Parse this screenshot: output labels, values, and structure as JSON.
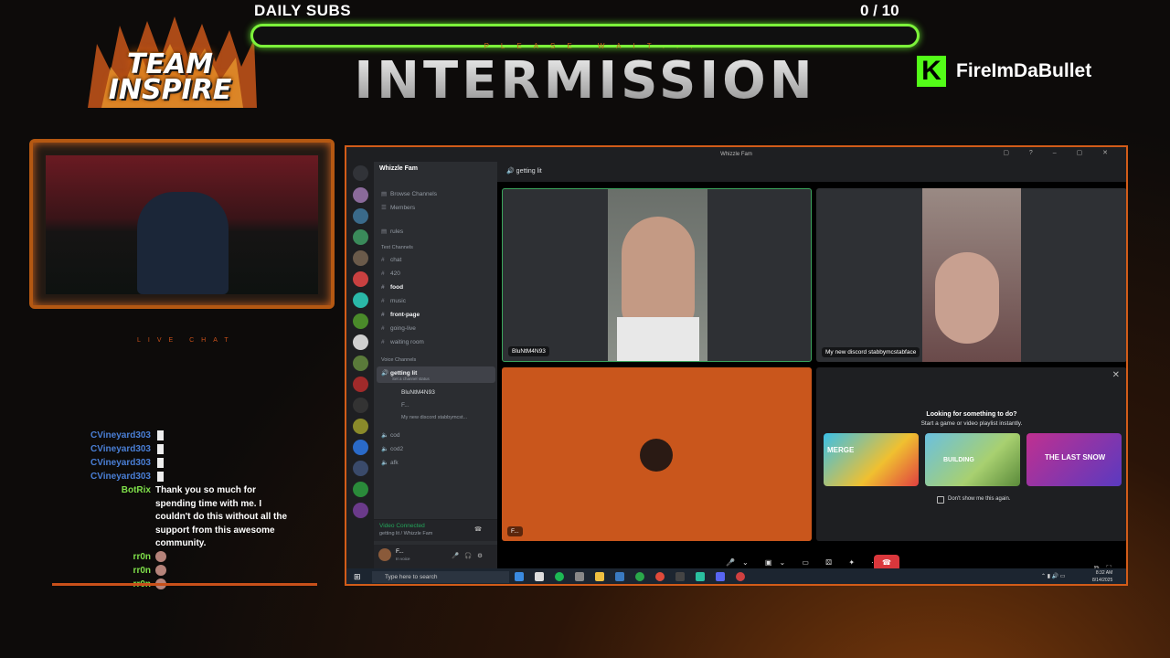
{
  "overlay": {
    "logo_line1": "TEAM",
    "logo_line2": "INSPIRE",
    "subs_label": "DAILY SUBS",
    "subs_count": "0  / 10",
    "subs_progress": 0,
    "please_wait": "PLEASE WAIT...",
    "title": "INTERMISSION",
    "channel": "FireImDaBullet",
    "live_chat": "LIVE CHAT",
    "accent": "#c8501a",
    "bar_color": "#7cf23a"
  },
  "chat": [
    {
      "user": "CVineyard303",
      "color": "#4a7fd6",
      "text": ""
    },
    {
      "user": "CVineyard303",
      "color": "#4a7fd6",
      "text": ""
    },
    {
      "user": "CVineyard303",
      "color": "#4a7fd6",
      "text": ""
    },
    {
      "user": "CVineyard303",
      "color": "#4a7fd6",
      "text": ""
    },
    {
      "user": "BotRix",
      "color": "#7fe04a",
      "text": "Thank you so much for spending time with me. I couldn't do this without all the support from this awesome community."
    },
    {
      "user": "rr0n",
      "color": "#7fe04a",
      "text": ""
    },
    {
      "user": "rr0n",
      "color": "#7fe04a",
      "text": ""
    },
    {
      "user": "rr0n",
      "color": "#7fe04a",
      "text": ""
    }
  ],
  "discord": {
    "window_title": "Whizzle Fam",
    "server_name": "Whizzle Fam",
    "browse": "Browse Channels",
    "members": "Members",
    "rules": "rules",
    "text_header": "Text Channels",
    "text_channels": [
      "chat",
      "420",
      "food",
      "music",
      "front-page",
      "going-live",
      "waiting room"
    ],
    "voice_header": "Voice Channels",
    "voice_active": "getting lit",
    "voice_status": "Set a channel status",
    "voice_users": [
      "BluNtM4N93",
      "F...",
      "My new discord stabbymcst..."
    ],
    "voice_channels": [
      "cod",
      "cod2",
      "afk"
    ],
    "vc_connected": "Video Connected",
    "vc_location": "getting lit / Whizzle Fam",
    "user_name": "F...",
    "user_status": "In voice",
    "header_channel": "getting lit",
    "tile1_name": "BluNtM4N93",
    "tile2_name": "My new discord stabbymcstabface",
    "tile3_name": "F...",
    "activity_title": "Looking for something to do?",
    "activity_sub": "Start a game or video playlist instantly.",
    "games": [
      "MERGE",
      "BUILDING",
      "THE LAST SNOW"
    ],
    "dont_show": "Don't show me this again."
  },
  "taskbar": {
    "search": "Type here to search",
    "time": "8:32 AM",
    "date": "8/14/2025"
  }
}
